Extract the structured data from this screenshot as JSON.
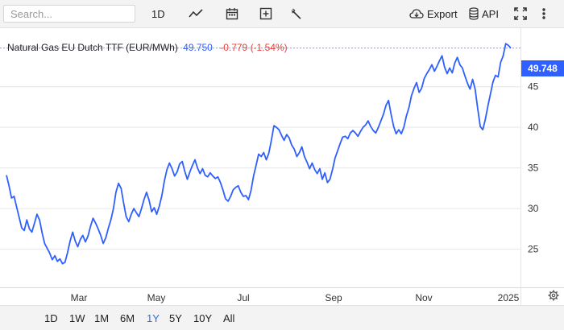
{
  "toolbar": {
    "search_placeholder": "Search...",
    "interval_label": "1D",
    "chart_type_icon": "line-chart-icon",
    "calendar_icon": "calendar-icon",
    "add_indicator_icon": "plus-square-icon",
    "settings_tool_icon": "wrench-icon",
    "export_label": "Export",
    "export_icon": "cloud-download-icon",
    "api_label": "API",
    "api_icon": "database-icon",
    "fullscreen_icon": "fullscreen-icon",
    "more_icon": "more-vertical-icon"
  },
  "legend": {
    "instrument": "Natural Gas EU Dutch TTF (EUR/MWh)",
    "last_price": "49.750",
    "change": "-0.779 (-1.54%)"
  },
  "price_tag": "49.748",
  "range_buttons": [
    "1D",
    "1W",
    "1M",
    "6M",
    "1Y",
    "5Y",
    "10Y",
    "All"
  ],
  "active_range": "1Y",
  "colors": {
    "line": "#2f5fff",
    "price_tag": "#2f5fff",
    "change_negative": "#e5403a",
    "active_range": "#2f6fde"
  },
  "chart_data": {
    "type": "line",
    "title": "Natural Gas EU Dutch TTF (EUR/MWh)",
    "x_tick_labels": [
      "Mar",
      "May",
      "Jul",
      "Sep",
      "Nov",
      "2025"
    ],
    "y_tick_labels": [
      "25",
      "30",
      "35",
      "40",
      "45"
    ],
    "ylim": [
      20.5,
      52.3
    ],
    "last_value": 49.748,
    "grid": "horizontal",
    "series": [
      {
        "values": [
          34.1,
          32.8,
          31.3,
          31.5,
          30.2,
          28.9,
          27.6,
          27.3,
          28.6,
          27.5,
          27.1,
          28.2,
          29.3,
          28.6,
          27.0,
          25.7,
          25.1,
          24.5,
          23.7,
          24.2,
          23.5,
          23.8,
          23.2,
          23.4,
          24.6,
          26.0,
          27.1,
          26.0,
          25.3,
          26.2,
          26.7,
          25.9,
          26.6,
          27.8,
          28.8,
          28.2,
          27.5,
          26.7,
          25.7,
          26.4,
          27.6,
          28.6,
          30.0,
          32.0,
          33.1,
          32.5,
          30.7,
          29.0,
          28.4,
          29.3,
          30.0,
          29.5,
          29.0,
          30.0,
          31.1,
          32.0,
          31.0,
          29.6,
          30.1,
          29.3,
          30.3,
          31.6,
          33.4,
          34.8,
          35.6,
          34.9,
          34.0,
          34.5,
          35.5,
          35.8,
          34.6,
          33.6,
          34.5,
          35.3,
          36.0,
          35.0,
          34.3,
          34.9,
          34.1,
          33.9,
          34.4,
          34.0,
          33.7,
          33.9,
          33.2,
          32.3,
          31.2,
          30.9,
          31.5,
          32.3,
          32.6,
          32.8,
          32.0,
          31.5,
          31.6,
          31.1,
          32.2,
          34.0,
          35.3,
          36.7,
          36.4,
          36.9,
          36.0,
          36.8,
          38.4,
          40.2,
          40.0,
          39.7,
          39.0,
          38.4,
          39.1,
          38.7,
          37.8,
          37.3,
          36.4,
          36.9,
          37.6,
          36.4,
          35.7,
          34.9,
          35.6,
          34.8,
          34.3,
          34.9,
          33.6,
          34.4,
          33.2,
          33.6,
          34.8,
          36.2,
          37.1,
          38.0,
          38.8,
          38.9,
          38.6,
          39.3,
          39.6,
          39.3,
          38.9,
          39.5,
          40.0,
          40.3,
          40.8,
          40.1,
          39.6,
          39.3,
          40.0,
          40.8,
          41.6,
          42.7,
          43.3,
          41.6,
          40.1,
          39.2,
          39.7,
          39.2,
          40.0,
          41.4,
          42.4,
          43.9,
          44.8,
          45.5,
          44.3,
          44.8,
          46.0,
          46.6,
          47.1,
          47.7,
          46.9,
          47.5,
          48.2,
          48.8,
          47.4,
          46.6,
          47.3,
          46.7,
          47.9,
          48.6,
          47.7,
          47.3,
          46.3,
          45.4,
          44.7,
          45.9,
          44.7,
          42.3,
          40.1,
          39.7,
          41.0,
          42.6,
          44.1,
          45.6,
          46.4,
          46.2,
          48.0,
          48.8,
          50.3,
          50.1,
          49.75
        ]
      }
    ]
  }
}
